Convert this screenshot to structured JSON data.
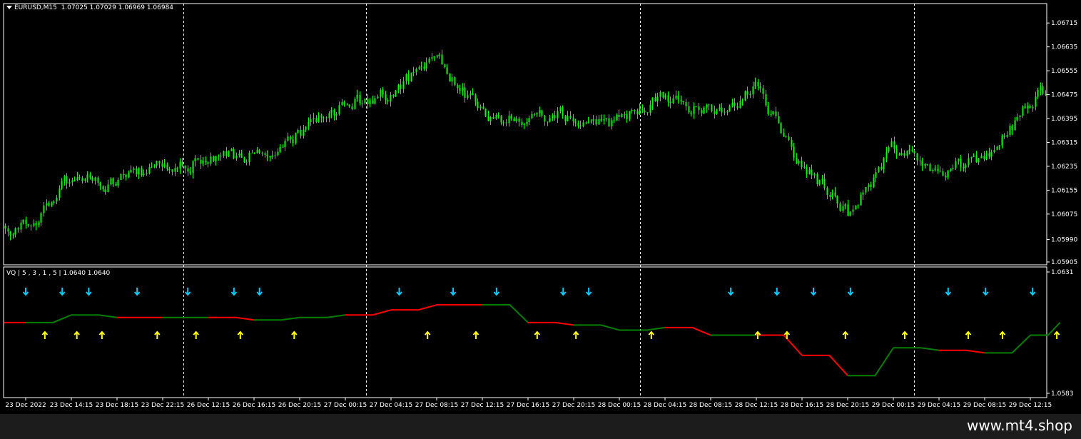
{
  "main_header": {
    "symbol_timeframe": "EURUSD,M15",
    "ohlc": "1.07025 1.07029 1.06969 1.06984"
  },
  "indicator_header": {
    "name": "VQ",
    "params": "5 , 3 , 1 , 5",
    "values": "1.0640 1.0640"
  },
  "watermark": "www.mt4.shop",
  "colors": {
    "background": "#000000",
    "candle": "#00ff00",
    "frame": "#ffffff",
    "vq_up": "#008000",
    "vq_down": "#ff0000",
    "arrow_up_signal": "#ffff00",
    "arrow_down_signal": "#00ccff"
  },
  "chart_data": [
    {
      "type": "candlestick",
      "title": "EURUSD,M15",
      "y_ticks": [
        "1.06715",
        "1.06635",
        "1.06555",
        "1.06475",
        "1.06395",
        "1.06315",
        "1.06235",
        "1.06155",
        "1.06075",
        "1.05990",
        "1.05905"
      ],
      "ylim": [
        1.05905,
        1.0678
      ],
      "x_labels": [
        "23 Dec 2022",
        "23 Dec 14:15",
        "23 Dec 18:15",
        "23 Dec 22:15",
        "26 Dec 12:15",
        "26 Dec 16:15",
        "26 Dec 20:15",
        "27 Dec 00:15",
        "27 Dec 04:15",
        "27 Dec 08:15",
        "27 Dec 12:15",
        "27 Dec 16:15",
        "27 Dec 20:15",
        "28 Dec 00:15",
        "28 Dec 04:15",
        "28 Dec 08:15",
        "28 Dec 12:15",
        "28 Dec 16:15",
        "28 Dec 20:15",
        "29 Dec 00:15",
        "29 Dec 04:15",
        "29 Dec 08:15",
        "29 Dec 12:15"
      ],
      "day_separators_after_label": [
        "23 Dec 22:15",
        "27 Dec 00:15",
        "28 Dec 00:15",
        "29 Dec 00:15"
      ],
      "close_path": [
        {
          "label": "23 Dec 2022",
          "v": 1.0603
        },
        {
          "label": "23 Dec 14:15",
          "v": 1.062
        },
        {
          "label": "23 Dec 18:15",
          "v": 1.0618
        },
        {
          "label": "23 Dec 22:15",
          "v": 1.0623
        },
        {
          "label": "26 Dec 12:15",
          "v": 1.0626
        },
        {
          "label": "26 Dec 16:15",
          "v": 1.0628
        },
        {
          "label": "26 Dec 20:15",
          "v": 1.0634
        },
        {
          "label": "27 Dec 00:15",
          "v": 1.0645
        },
        {
          "label": "27 Dec 04:15",
          "v": 1.0648
        },
        {
          "label": "27 Dec 08:15",
          "v": 1.066
        },
        {
          "label": "27 Dec 12:15",
          "v": 1.064
        },
        {
          "label": "27 Dec 16:15",
          "v": 1.064
        },
        {
          "label": "27 Dec 20:15",
          "v": 1.064
        },
        {
          "label": "28 Dec 00:15",
          "v": 1.0638
        },
        {
          "label": "28 Dec 04:15",
          "v": 1.0646
        },
        {
          "label": "28 Dec 08:15",
          "v": 1.0641
        },
        {
          "label": "28 Dec 12:15",
          "v": 1.065
        },
        {
          "label": "28 Dec 16:15",
          "v": 1.0623
        },
        {
          "label": "28 Dec 20:15",
          "v": 1.0608
        },
        {
          "label": "29 Dec 00:15",
          "v": 1.063
        },
        {
          "label": "29 Dec 04:15",
          "v": 1.0623
        },
        {
          "label": "29 Dec 08:15",
          "v": 1.0625
        },
        {
          "label": "29 Dec 12:15",
          "v": 1.0645
        },
        {
          "label": "last",
          "v": 1.0652
        }
      ]
    },
    {
      "type": "line",
      "title": "VQ | 5 , 3 , 1 , 5 | 1.0640 1.0640",
      "y_ticks": [
        "1.0631",
        "1.0583"
      ],
      "ylim": [
        1.0583,
        1.0631
      ],
      "series": [
        {
          "name": "VQ",
          "values": [
            {
              "label": "23 Dec 2022",
              "v": 1.0611,
              "trend": "down"
            },
            {
              "label": "23 Dec 14:15",
              "v": 1.0614,
              "trend": "up"
            },
            {
              "label": "23 Dec 18:15",
              "v": 1.0613,
              "trend": "up"
            },
            {
              "label": "23 Dec 22:15",
              "v": 1.0613,
              "trend": "down"
            },
            {
              "label": "26 Dec 12:15",
              "v": 1.0613,
              "trend": "up"
            },
            {
              "label": "26 Dec 16:15",
              "v": 1.0612,
              "trend": "down"
            },
            {
              "label": "26 Dec 20:15",
              "v": 1.0613,
              "trend": "up"
            },
            {
              "label": "27 Dec 00:15",
              "v": 1.0614,
              "trend": "up"
            },
            {
              "label": "27 Dec 04:15",
              "v": 1.0616,
              "trend": "down"
            },
            {
              "label": "27 Dec 08:15",
              "v": 1.0618,
              "trend": "down"
            },
            {
              "label": "27 Dec 12:15",
              "v": 1.0618,
              "trend": "down"
            },
            {
              "label": "27 Dec 16:15",
              "v": 1.0611,
              "trend": "up"
            },
            {
              "label": "27 Dec 20:15",
              "v": 1.061,
              "trend": "down"
            },
            {
              "label": "28 Dec 00:15",
              "v": 1.0608,
              "trend": "up"
            },
            {
              "label": "28 Dec 04:15",
              "v": 1.0609,
              "trend": "up"
            },
            {
              "label": "28 Dec 08:15",
              "v": 1.0606,
              "trend": "down"
            },
            {
              "label": "28 Dec 12:15",
              "v": 1.0606,
              "trend": "up"
            },
            {
              "label": "28 Dec 16:15",
              "v": 1.0598,
              "trend": "down"
            },
            {
              "label": "28 Dec 20:15",
              "v": 1.059,
              "trend": "down"
            },
            {
              "label": "29 Dec 00:15",
              "v": 1.0601,
              "trend": "up"
            },
            {
              "label": "29 Dec 04:15",
              "v": 1.06,
              "trend": "up"
            },
            {
              "label": "29 Dec 08:15",
              "v": 1.0599,
              "trend": "down"
            },
            {
              "label": "29 Dec 12:15",
              "v": 1.0606,
              "trend": "up"
            },
            {
              "label": "last",
              "v": 1.0611,
              "trend": "up"
            }
          ]
        }
      ],
      "signals": [
        {
          "label": "23 Dec 2022",
          "offset": 0.42,
          "dir": "up"
        },
        {
          "label": "23 Dec 2022",
          "offset": 0.0,
          "dir": "down"
        },
        {
          "label": "23 Dec 2022",
          "offset": 0.8,
          "dir": "down"
        },
        {
          "label": "23 Dec 14:15",
          "offset": 0.12,
          "dir": "up"
        },
        {
          "label": "23 Dec 14:15",
          "offset": 0.38,
          "dir": "down"
        },
        {
          "label": "23 Dec 14:15",
          "offset": 0.67,
          "dir": "up"
        },
        {
          "label": "23 Dec 18:15",
          "offset": 0.44,
          "dir": "down"
        },
        {
          "label": "23 Dec 18:15",
          "offset": 0.88,
          "dir": "up"
        },
        {
          "label": "23 Dec 22:15",
          "offset": 0.55,
          "dir": "down"
        },
        {
          "label": "23 Dec 22:15",
          "offset": 0.73,
          "dir": "up"
        },
        {
          "label": "26 Dec 12:15",
          "offset": 0.56,
          "dir": "down"
        },
        {
          "label": "26 Dec 12:15",
          "offset": 0.7,
          "dir": "up"
        },
        {
          "label": "26 Dec 16:15",
          "offset": 0.12,
          "dir": "down"
        },
        {
          "label": "26 Dec 16:15",
          "offset": 0.88,
          "dir": "up"
        },
        {
          "label": "27 Dec 04:15",
          "offset": 0.18,
          "dir": "down"
        },
        {
          "label": "27 Dec 04:15",
          "offset": 0.8,
          "dir": "up"
        },
        {
          "label": "27 Dec 04:15",
          "offset": 1.36,
          "dir": "down"
        },
        {
          "label": "27 Dec 08:15",
          "offset": 0.86,
          "dir": "up"
        },
        {
          "label": "27 Dec 12:15",
          "offset": 0.31,
          "dir": "down"
        },
        {
          "label": "27 Dec 16:15",
          "offset": 0.2,
          "dir": "up"
        },
        {
          "label": "27 Dec 16:15",
          "offset": 0.77,
          "dir": "down"
        },
        {
          "label": "27 Dec 16:15",
          "offset": 1.05,
          "dir": "up"
        },
        {
          "label": "27 Dec 16:15",
          "offset": 1.33,
          "dir": "down"
        },
        {
          "label": "28 Dec 00:15",
          "offset": 0.7,
          "dir": "up"
        },
        {
          "label": "28 Dec 08:15",
          "offset": 0.44,
          "dir": "down"
        },
        {
          "label": "28 Dec 12:15",
          "offset": 0.03,
          "dir": "up"
        },
        {
          "label": "28 Dec 12:15",
          "offset": 0.45,
          "dir": "down"
        },
        {
          "label": "28 Dec 12:15",
          "offset": 0.67,
          "dir": "up"
        },
        {
          "label": "28 Dec 16:15",
          "offset": 0.25,
          "dir": "down"
        },
        {
          "label": "28 Dec 16:15",
          "offset": 0.95,
          "dir": "up"
        },
        {
          "label": "28 Dec 20:15",
          "offset": 0.06,
          "dir": "down"
        },
        {
          "label": "29 Dec 00:15",
          "offset": 0.25,
          "dir": "up"
        },
        {
          "label": "29 Dec 04:15",
          "offset": 0.2,
          "dir": "down"
        },
        {
          "label": "29 Dec 04:15",
          "offset": 0.64,
          "dir": "up"
        },
        {
          "label": "29 Dec 08:15",
          "offset": 0.02,
          "dir": "down"
        },
        {
          "label": "29 Dec 08:15",
          "offset": 0.39,
          "dir": "up"
        },
        {
          "label": "29 Dec 12:15",
          "offset": 0.05,
          "dir": "down"
        },
        {
          "label": "29 Dec 12:15",
          "offset": 0.58,
          "dir": "up"
        }
      ]
    }
  ]
}
